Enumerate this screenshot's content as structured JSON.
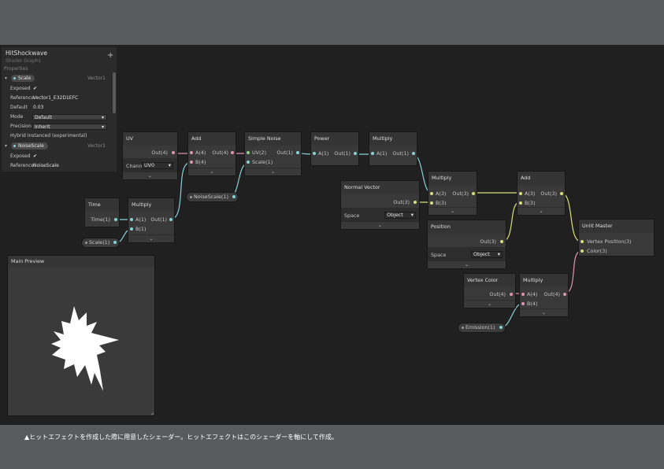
{
  "blackboard": {
    "title": "HitShockwave",
    "subtitle": "Shader Graphs",
    "section": "Properties",
    "add_icon": "+",
    "props": [
      {
        "name": "Scale",
        "type": "Vector1",
        "exposed_label": "Exposed",
        "exposed_value": "✔",
        "reference_label": "Reference",
        "reference_value": "Vector1_E32D1EFC",
        "default_label": "Default",
        "default_value": "0.03",
        "mode_label": "Mode",
        "mode_value": "Default",
        "precision_label": "Precision",
        "precision_value": "Inherit",
        "hybrid_label": "Hybrid Instanced (experimental)"
      },
      {
        "name": "NoiseScale",
        "type": "Vector1",
        "exposed_label": "Exposed",
        "exposed_value": "✔",
        "reference_label": "Reference",
        "reference_value": "NoiseScale"
      }
    ]
  },
  "nodes": {
    "uv": {
      "title": "UV",
      "out": "Out(4)",
      "channel_label": "Channel",
      "channel_value": "UV0"
    },
    "add1": {
      "title": "Add",
      "in_a": "A(4)",
      "in_b": "B(4)",
      "out": "Out(4)"
    },
    "simple_noise": {
      "title": "Simple Noise",
      "in_uv": "UV(2)",
      "in_scale": "Scale(1)",
      "out": "Out(1)"
    },
    "power": {
      "title": "Power",
      "in_a": "A(1)",
      "out": "Out(1)"
    },
    "multiply1": {
      "title": "Multiply",
      "in_a": "A(1)",
      "out": "Out(1)"
    },
    "time": {
      "title": "Time",
      "out": "Time(1)"
    },
    "multiply2": {
      "title": "Multiply",
      "in_a": "A(1)",
      "in_b": "B(1)",
      "out": "Out(1)"
    },
    "normal_vector": {
      "title": "Normal Vector",
      "out": "Out(3)",
      "space_label": "Space",
      "space_value": "Object"
    },
    "multiply3": {
      "title": "Multiply",
      "in_a": "A(3)",
      "in_b": "B(3)",
      "out": "Out(3)"
    },
    "position": {
      "title": "Position",
      "out": "Out(3)",
      "space_label": "Space",
      "space_value": "Object"
    },
    "add2": {
      "title": "Add",
      "in_a": "A(3)",
      "in_b": "B(3)",
      "out": "Out(3)"
    },
    "unlit_master": {
      "title": "Unlit Master",
      "in_vertex": "Vertex Position(3)",
      "in_color": "Color(3)"
    },
    "vertex_color": {
      "title": "Vertex Color",
      "out": "Out(4)"
    },
    "multiply4": {
      "title": "Multiply",
      "in_a": "A(4)",
      "in_b": "B(4)",
      "out": "Out(4)"
    }
  },
  "property_nodes": {
    "noise_scale": "NoiseScale(1)",
    "scale": "Scale(1)",
    "emission": "Emission(1)"
  },
  "preview": {
    "title": "Main Preview"
  },
  "caption": "▲ヒットエフェクトを作成した際に用意したシェーダー。ヒットエフェクトはこのシェーダーを軸にして作成。",
  "colors": {
    "port_vector1": "#86d2d8",
    "port_vector3": "#d9e07a",
    "port_vector4": "#e094b2"
  }
}
